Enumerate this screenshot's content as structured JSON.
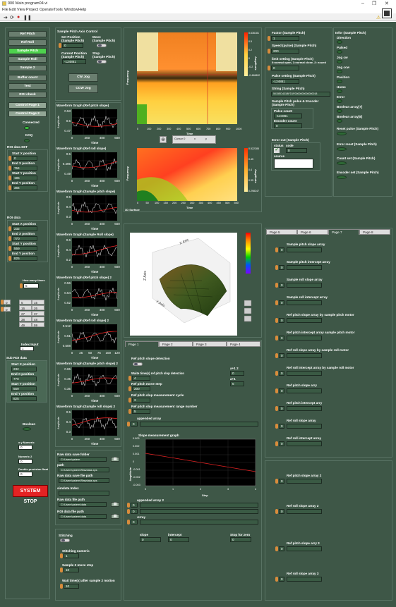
{
  "window": {
    "title": "000 Main program04.vi",
    "min": "–",
    "max": "❐",
    "close": "✕"
  },
  "menu": [
    "File",
    "Edit",
    "View",
    "Project",
    "Operate",
    "Tools",
    "Window",
    "Help"
  ],
  "left_buttons": [
    "Ref Pitch",
    "Ref Roll",
    "Sample Pitch",
    "Sample Roll",
    "Sample 2",
    "Buffer count",
    "Test",
    "ROI check",
    "Control Page 1",
    "Control Page 2"
  ],
  "connected": "Connected",
  "daq": "DAQ",
  "roi_set": {
    "title": "ROI data SET",
    "labels": [
      "Start X position",
      "End X position",
      "Start Y position",
      "End Y position"
    ],
    "values": [
      "0",
      "764",
      "195",
      "384"
    ]
  },
  "roi_data": {
    "title": "ROI data",
    "labels": [
      "Start X position",
      "End X position",
      "Start Y position",
      "End Y position"
    ],
    "values": [
      "232",
      "770",
      "559",
      "825"
    ]
  },
  "how_many": {
    "label": "How many times",
    "value": "5"
  },
  "table": {
    "rows": [
      [
        "5",
        "15"
      ],
      [
        "16",
        "26"
      ],
      [
        "27",
        "37"
      ],
      [
        "38",
        "48"
      ],
      [
        "49",
        "59"
      ]
    ],
    "indices": [
      "0",
      "0"
    ]
  },
  "index_input": {
    "label": "Index Input",
    "value": "1"
  },
  "sub_roi": {
    "title": "Sub ROI data",
    "labels": [
      "Start X position",
      "End X position",
      "Start Y position",
      "End Y position"
    ],
    "values": [
      "232",
      "770",
      "559",
      "825"
    ]
  },
  "boolean": "Boolean",
  "bottom_fields": [
    {
      "label": "x y Numeric",
      "value": "0"
    },
    {
      "label": "Numeric 2",
      "value": "0"
    },
    {
      "label": "Double precision float",
      "value": "0"
    }
  ],
  "system_stop": "SYSTEM STOP",
  "axis_control": {
    "title": "Sample Pitch  Axis Control",
    "set_pos": "Set Position\n(Sample Pitch)",
    "set_val": "0",
    "move": "Move\n(Sample Pitch)",
    "cur_pos": "Current Position\n(Sample Pitch)",
    "cur_val": "-124861",
    "stop": "Stop\n(Sample Pitch)",
    "cw": "CW Jog",
    "ccw": "CCW Jog"
  },
  "waveforms": [
    {
      "title": "Waveform Graph (Ref pitch slope)",
      "ylabel": "Amplitude",
      "xlabel": "Time",
      "yt": [
        "0.53",
        "0.5",
        "0.47"
      ],
      "xt": [
        "0",
        "200",
        "400",
        "600"
      ]
    },
    {
      "title": "Waveform Graph (Ref roll slope)",
      "ylabel": "Amplitude",
      "xlabel": "Time",
      "yt": [
        "0.5",
        "0.495",
        "0.49"
      ],
      "xt": [
        "0",
        "200",
        "400",
        "600"
      ]
    },
    {
      "title": "Waveform Graph (Sample pitch slope)",
      "ylabel": "Amplitude",
      "xlabel": "Time",
      "yt": [
        "0.5",
        "0.4",
        "0.3"
      ],
      "xt": [
        "0",
        "200",
        "400",
        "600"
      ]
    },
    {
      "title": "Waveform Graph (Sample Roll slope)",
      "ylabel": "Amplitude",
      "xlabel": "Time",
      "yt": [
        "0.6",
        "0.4",
        "0.2"
      ],
      "xt": [
        "0",
        "200",
        "400",
        "600"
      ]
    },
    {
      "title": "Waveform Graph (Ref pitch slope) 2",
      "ylabel": "Amplitude",
      "xlabel": "Time",
      "yt": [
        "0.56",
        "0.54",
        "0.52"
      ],
      "xt": [
        "0",
        "200",
        "400",
        "600"
      ]
    },
    {
      "title": "Waveform Graph (Ref roll slope) 2",
      "ylabel": "Amplitude",
      "xlabel": "Time",
      "yt": [
        "0.512",
        "0.51",
        "0.508"
      ],
      "xt": [
        "0",
        "25",
        "50",
        "75",
        "100",
        "120"
      ]
    },
    {
      "title": "Waveform Graph (Sample pitch slope) 2",
      "ylabel": "Amplitude",
      "xlabel": "Time",
      "yt": [
        "0.65",
        "0.45",
        "0.35"
      ],
      "xt": [
        "0",
        "200",
        "400",
        "600"
      ]
    },
    {
      "title": "Waveform Graph (Sample roll slope) 2",
      "ylabel": "Amplitude",
      "xlabel": "Time",
      "yt": [
        "0.5",
        "0.4",
        "0.3"
      ],
      "xt": [
        "0",
        "200",
        "400",
        "600"
      ]
    }
  ],
  "image1": {
    "ylabel": "Frequency",
    "xlabel": "Time",
    "xt": [
      "0",
      "100",
      "200",
      "300",
      "400",
      "500",
      "600",
      "700",
      "800",
      "900",
      "1000"
    ],
    "scale": [
      "0.636181",
      "0.5",
      "0.2",
      "0",
      "-0.2",
      "-0.466802"
    ],
    "scale_label": "Amplitude"
  },
  "image2": {
    "ylabel": "Frequency",
    "xlabel": "Time",
    "xt": [
      "0",
      "50",
      "100",
      "150",
      "200",
      "250",
      "300",
      "350",
      "400",
      "450",
      "500",
      "550"
    ],
    "scale": [
      "0.522285",
      "0.45",
      "0.4",
      "0.35",
      "0.298247"
    ],
    "scale_label": "Amplitude",
    "surface_label": "3D Surface"
  },
  "cursor": {
    "label": "Cursor 0",
    "x": "x",
    "y": "y"
  },
  "surface3d": {
    "xaxis": "X Axis",
    "yaxis": "Y Axis",
    "zaxis": "Z Axis"
  },
  "bottom_tabs": [
    "Page 1",
    "Page 2",
    "Page 3",
    "Page 4"
  ],
  "page1": {
    "detection": "Ref pitch slope detection",
    "wait_time": "Waite time(s) ref pitch slop detection",
    "wait_val": "4",
    "a_label": "a+1 2",
    "a_val": "0",
    "move_step": "Ref pitch move step",
    "move_val": "200",
    "a2_label": "a+1",
    "a2_val": "5",
    "cycle": "Ref pitch slop measurement cycle",
    "cycle_val": "3",
    "range": "Ref pitch slop measurement range number",
    "range_val": "5",
    "appended": "appended array",
    "appended_idx": "0",
    "graph_title": "Slope measurement graph",
    "graph_y": [
      "0.003",
      "0.002",
      "0.001",
      "0",
      "-0.001",
      "-0.002",
      "-0.003"
    ],
    "graph_x": [
      "0",
      "1",
      "2",
      "3",
      "4"
    ],
    "graph_xl": "Step",
    "graph_yl": "Amplitude",
    "appended2": "appended array 2",
    "array": "Array",
    "idx": [
      "0",
      "0",
      "0"
    ],
    "slope": "slope",
    "slope_val": "0",
    "intercept": "intercept",
    "intercept_val": "0",
    "stop_zero": "Stop for zero",
    "stop_val": "0"
  },
  "raw": {
    "folder_label": "Raw data save folder",
    "folder_val": "C:\\Users\\ystem",
    "path_label": "path",
    "path_val": "C:\\Users\\ystem\\Rawdata.xps",
    "file_label": "Raw data save file path",
    "file_val": "C:\\Users\\ystem\\Rawdata.xps",
    "simdata": "simdata Index",
    "raw_path": "Raw data file path",
    "raw_path_val": "C:\\Users\\ystem\\data",
    "roi_path": "ROI data file path",
    "roi_path_val": "C:\\Users\\ystem\\data"
  },
  "stitching": {
    "title": "Stitching",
    "numeric": "Stitching numeric",
    "num_val": "1",
    "sample2": "Sample 2 move step",
    "s2_val": "10",
    "wait": "Wait time(s) after sample 2 motion",
    "wait_val": "10"
  },
  "factor": {
    "factor": "Factor (Sample Pitch)",
    "factor_val": "1",
    "speed": "Speed (pulse) (Sample Pitch)",
    "speed_val": "200",
    "limit": "limit setting (Sample Pitch)",
    "limit_desc": "0:normal open, 1:normal close, 2: noued",
    "limit_val": "0",
    "pulse": "Pulse setting (Sample Pitch)",
    "pulse_val": "-124861",
    "string": "String (Sample Pitch)",
    "string_val": "5015ED431BFD1F0000000000000018",
    "sp_pulse": "Sample Pitch pulse & Encoder (Sample Pitch)",
    "pulse_count": "Pulse count",
    "pulse_count_val": "-124861",
    "enc": "Encoder count",
    "enc_val": "0",
    "error": "Error out (Sample Pitch)",
    "status": "status",
    "code": "code",
    "code_val": "0",
    "source": "source"
  },
  "infor": {
    "title": "Infor (Sample Pitch)",
    "items": [
      "Direction",
      "Pulsed",
      "Jog cw",
      "Jog ccw",
      "Position",
      "Home",
      "Error",
      "Boolean array[7]",
      "Boolean array[8]"
    ],
    "reset": "Reset pulse (Sample Pitch)",
    "err_reset": "Error reset (Sample Pitch)",
    "count": "Count set (Sample Pitch)",
    "enc_set": "Encoder set (Sample Pitch)"
  },
  "right_tabs": [
    "Page 5",
    "Page 6",
    "Page 7",
    "Page 8"
  ],
  "right_list": [
    "Sample pitch slope array",
    "Sample pitch intercept array",
    "Sample roll slope array",
    "Sample roll intercept array",
    "Ref pitch slope array by sample pitch motor",
    "Ref pitch intercept array sample pitch motor",
    "Ref roll slope array  by sample roll motor",
    "Ref roll intercept array by sample roll motor",
    "Ref pitch slope arry",
    "Ref pitch intercept arry",
    "Ref roll slope array",
    "Ref roll intercept array"
  ],
  "right_list_idx": "0",
  "right_bottom": [
    "Ref pitch slope array 2",
    "Ref roll slope array 2",
    "Ref pitch slope arry 3",
    "Ref roll slope array 3"
  ],
  "colors": {
    "panel": "#3e5747",
    "on": "#4ed24e",
    "stop": "#e42323",
    "plot_red": "#e32222",
    "plot_white": "#ffffff"
  }
}
